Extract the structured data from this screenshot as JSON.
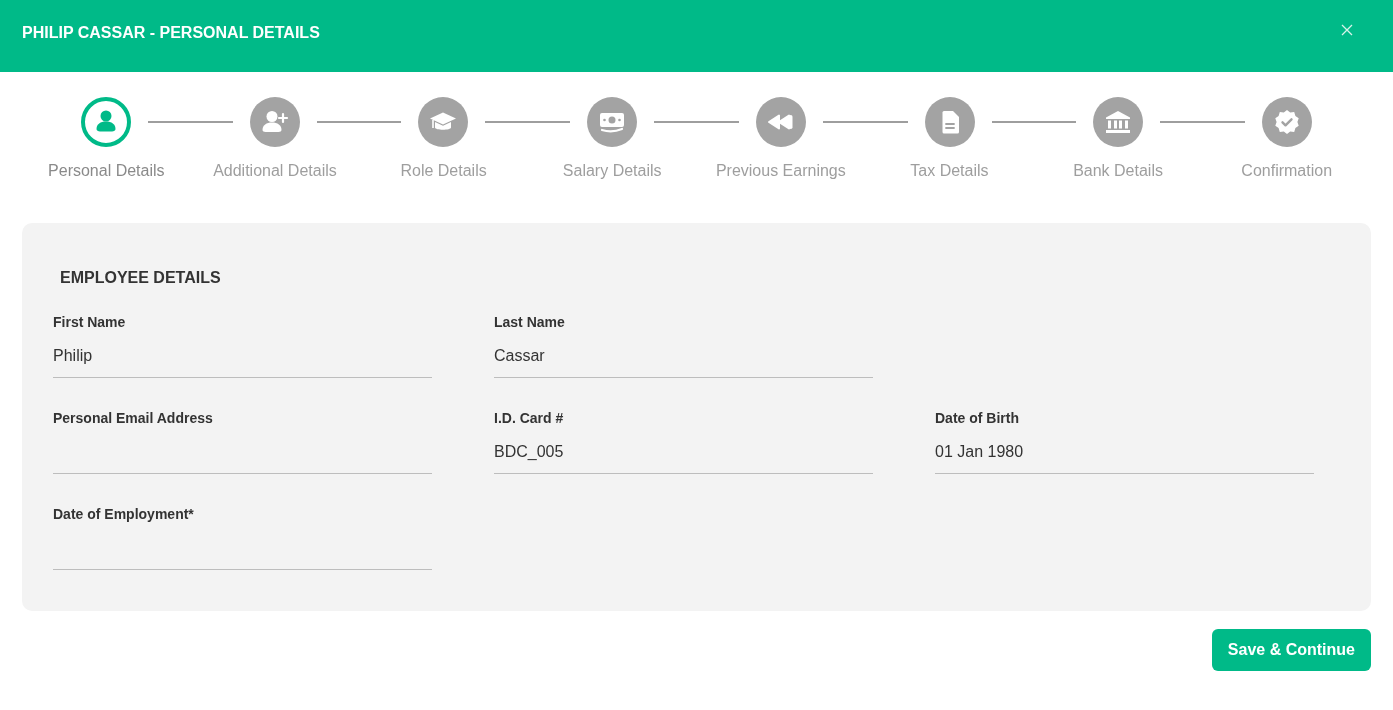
{
  "window": {
    "title": "PHILIP CASSAR - PERSONAL DETAILS"
  },
  "steps": [
    {
      "label": "Personal Details",
      "selected": true
    },
    {
      "label": "Additional Details",
      "selected": false
    },
    {
      "label": "Role Details",
      "selected": false
    },
    {
      "label": "Salary Details",
      "selected": false
    },
    {
      "label": "Previous Earnings",
      "selected": false
    },
    {
      "label": "Tax Details",
      "selected": false
    },
    {
      "label": "Bank Details",
      "selected": false
    },
    {
      "label": "Confirmation",
      "selected": false
    }
  ],
  "employee_details": {
    "title": "EMPLOYEE DETAILS",
    "rows": [
      [
        {
          "label": "First Name",
          "value": "Philip"
        },
        {
          "label": "Last Name",
          "value": "Cassar"
        }
      ],
      [
        {
          "label": "Personal Email Address"
        },
        {
          "label": "I.D. Card #",
          "value": "BDC_005"
        },
        {
          "label": "Date of Birth",
          "value": "01 Jan 1980"
        }
      ],
      [
        {
          "label": "Date of Employment*"
        }
      ]
    ]
  },
  "buttons": [
    "Save & Continue"
  ]
}
